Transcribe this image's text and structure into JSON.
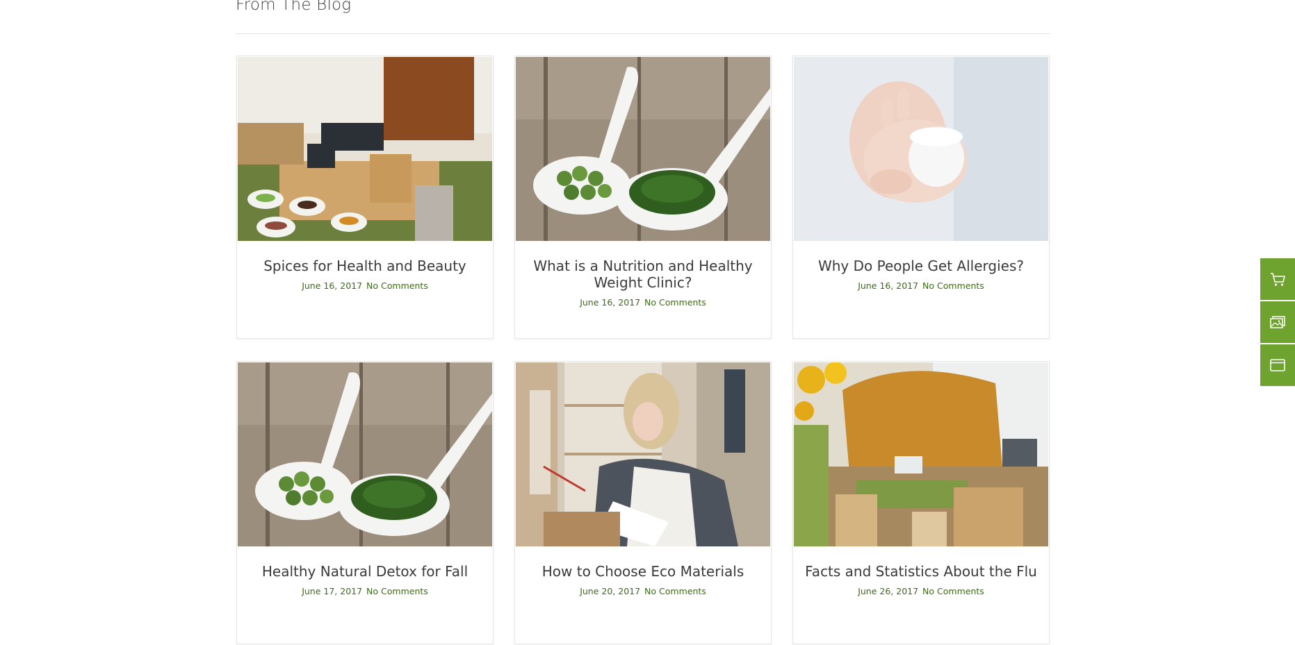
{
  "section": {
    "title": "From The Blog"
  },
  "posts": [
    {
      "title": "Spices for Health and Beauty",
      "date": "June 16, 2017",
      "comments": "No Comments",
      "image": "soap-making-spices-photo"
    },
    {
      "title": "What is a Nutrition and Healthy Weight Clinic?",
      "date": "June 16, 2017",
      "comments": "No Comments",
      "image": "green-spoons-photo"
    },
    {
      "title": "Why Do People Get Allergies?",
      "date": "June 16, 2017",
      "comments": "No Comments",
      "image": "cream-jar-hands-photo"
    },
    {
      "title": "Healthy Natural Detox for Fall",
      "date": "June 17, 2017",
      "comments": "No Comments",
      "image": "green-spoons-photo"
    },
    {
      "title": "How to Choose Eco Materials",
      "date": "June 20, 2017",
      "comments": "No Comments",
      "image": "woman-writing-shelf-photo"
    },
    {
      "title": "Facts and Statistics About the Flu",
      "date": "June 26, 2017",
      "comments": "No Comments",
      "image": "soap-workshop-flowers-photo"
    }
  ],
  "side_dock": [
    {
      "icon": "cart-icon"
    },
    {
      "icon": "gallery-icon"
    },
    {
      "icon": "browser-window-icon"
    }
  ],
  "colors": {
    "accent": "#6ea32f",
    "meta_text": "#3b6b14",
    "title_text": "#3a3a3a"
  }
}
